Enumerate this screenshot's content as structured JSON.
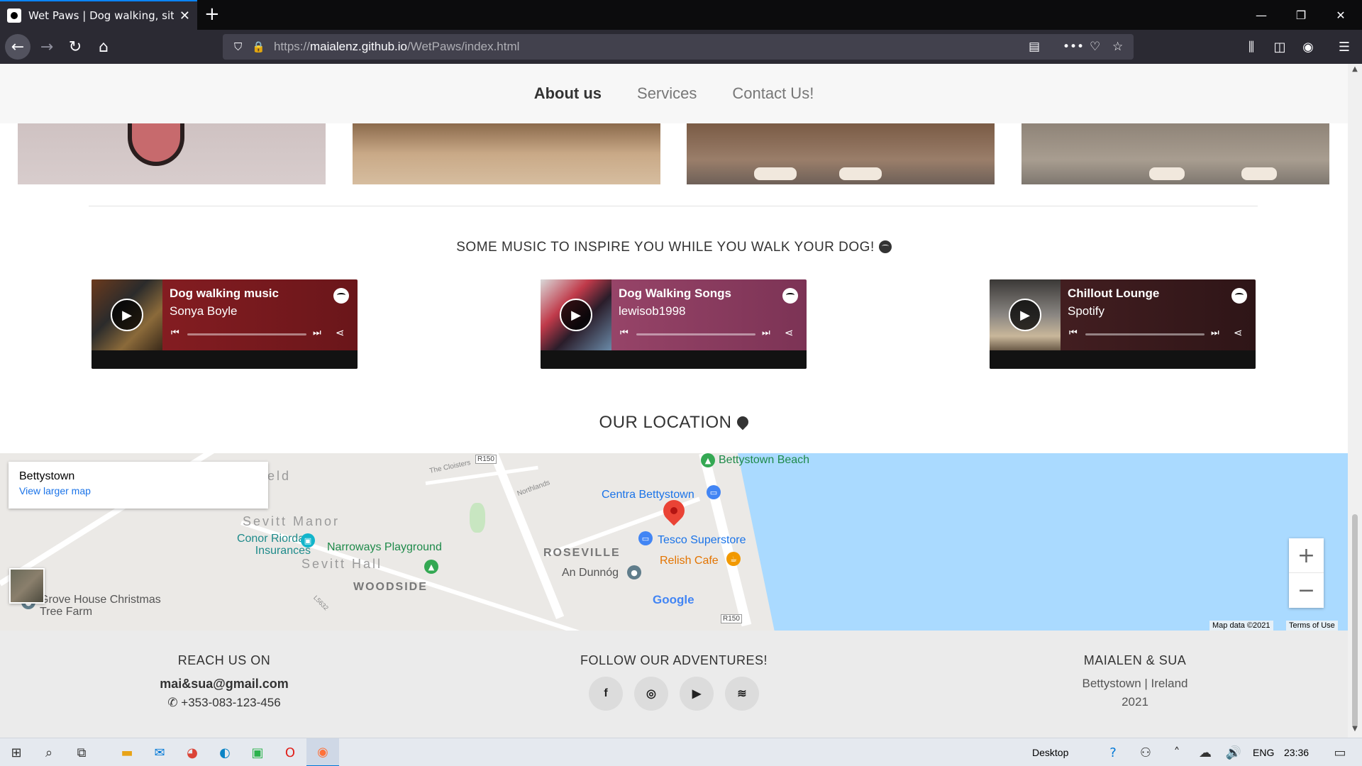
{
  "browser": {
    "tab_title": "Wet Paws | Dog walking, sitting",
    "url_scheme": "https://",
    "url_host": "maialenz.github.io",
    "url_path": "/WetPaws/index.html"
  },
  "site_nav": {
    "items": [
      "About us",
      "Services",
      "Contact Us!"
    ],
    "active": "About us"
  },
  "music": {
    "title": "SOME MUSIC TO INSPIRE YOU WHILE YOU WALK YOUR DOG!",
    "players": [
      {
        "name": "Dog walking music",
        "artist": "Sonya Boyle",
        "color": "#8d1f24"
      },
      {
        "name": "Dog Walking Songs",
        "artist": "lewisob1998",
        "color": "#a04a6f"
      },
      {
        "name": "Chillout Lounge",
        "artist": "Spotify",
        "color": "#4a2124"
      }
    ]
  },
  "location": {
    "title": "OUR LOCATION",
    "map": {
      "place": "Bettystown",
      "view_larger": "View larger map",
      "labels": {
        "beach": "Bettystown Beach",
        "centra": "Centra Bettystown",
        "tesco": "Tesco Superstore",
        "relish": "Relish Cafe",
        "dunnog": "An Dunnóg",
        "roseville": "ROSEVILLE",
        "woodside": "WOODSIDE",
        "sevitt_manor": "Sevitt Manor",
        "sevitt_hall": "Sevitt Hall",
        "conor": "Conor Riordan Insurances",
        "narroways": "Narroways Playground",
        "grove": "Grove House Christmas Tree Farm",
        "cloisters": "The Cloisters",
        "northlands": "Northlands",
        "r150a": "R150",
        "r150b": "R150",
        "l5632": "L5632",
        "eld": "eld"
      },
      "google": "Google",
      "map_data": "Map data ©2021",
      "terms": "Terms of Use"
    }
  },
  "footer": {
    "reach_title": "REACH US ON",
    "email": "mai&sua@gmail.com",
    "phone": "+353-083-123-456",
    "follow_title": "FOLLOW OUR ADVENTURES!",
    "social_icons": [
      "facebook-icon",
      "instagram-icon",
      "youtube-icon",
      "spotify-icon"
    ],
    "brand_title": "MAIALEN & SUA",
    "brand_location": "Bettystown | Ireland",
    "brand_year": "2021"
  },
  "taskbar": {
    "desktop_label": "Desktop",
    "language": "ENG",
    "time": "23:36"
  }
}
